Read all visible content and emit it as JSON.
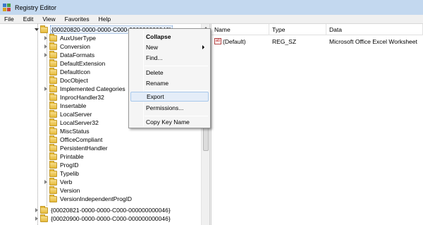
{
  "window": {
    "title": "Registry Editor",
    "icon": "registry-editor-icon"
  },
  "menubar": [
    "File",
    "Edit",
    "View",
    "Favorites",
    "Help"
  ],
  "tree": {
    "selected": "{00020820-0000-0000-C000-000000000046}",
    "children": [
      "AuxUserType",
      "Conversion",
      "DataFormats",
      "DefaultExtension",
      "DefaultIcon",
      "DocObject",
      "Implemented Categories",
      "InprocHandler32",
      "Insertable",
      "LocalServer",
      "LocalServer32",
      "MiscStatus",
      "OfficeCompliant",
      "PersistentHandler",
      "Printable",
      "ProgID",
      "Typelib",
      "Verb",
      "Version",
      "VersionIndependentProgID"
    ],
    "siblings_after": [
      "{00020821-0000-0000-C000-000000000046}",
      "{00020900-0000-0000-C000-000000000046}"
    ]
  },
  "list": {
    "columns": [
      "Name",
      "Type",
      "Data"
    ],
    "rows": [
      {
        "name": "(Default)",
        "type": "REG_SZ",
        "data": "Microsoft Office Excel Worksheet",
        "icon": "ab-string-icon"
      }
    ]
  },
  "context_menu": {
    "items": [
      "Collapse",
      "New",
      "Find...",
      "Delete",
      "Rename",
      "Export",
      "Permissions...",
      "Copy Key Name"
    ],
    "default_item": "Collapse",
    "submenu_item": "New",
    "hovered_item": "Export"
  }
}
